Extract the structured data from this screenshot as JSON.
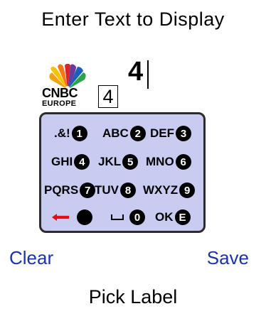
{
  "title": "Enter Text to Display",
  "logo": {
    "brand": "CNBC",
    "region": "EUROPE"
  },
  "entry_box_value": "4",
  "display_text": "4",
  "keypad": {
    "row1": [
      {
        "label": ".&!",
        "num": "1"
      },
      {
        "label": "ABC",
        "num": "2"
      },
      {
        "label": "DEF",
        "num": "3"
      }
    ],
    "row2": [
      {
        "label": "GHI",
        "num": "4"
      },
      {
        "label": "JKL",
        "num": "5"
      },
      {
        "label": "MNO",
        "num": "6"
      }
    ],
    "row3": [
      {
        "label": "PQRS",
        "num": "7"
      },
      {
        "label": "TUV",
        "num": "8"
      },
      {
        "label": "WXYZ",
        "num": "9"
      }
    ],
    "row4": {
      "zero": "0",
      "ok_label": "OK",
      "ok_key": "E"
    }
  },
  "softkeys": {
    "left": "Clear",
    "right": "Save"
  },
  "bottom_label": "Pick Label",
  "colors": {
    "softkey": "#1a33a8",
    "keypad_bg": "#c8ccf0",
    "backspace_arrow": "#e01010"
  }
}
